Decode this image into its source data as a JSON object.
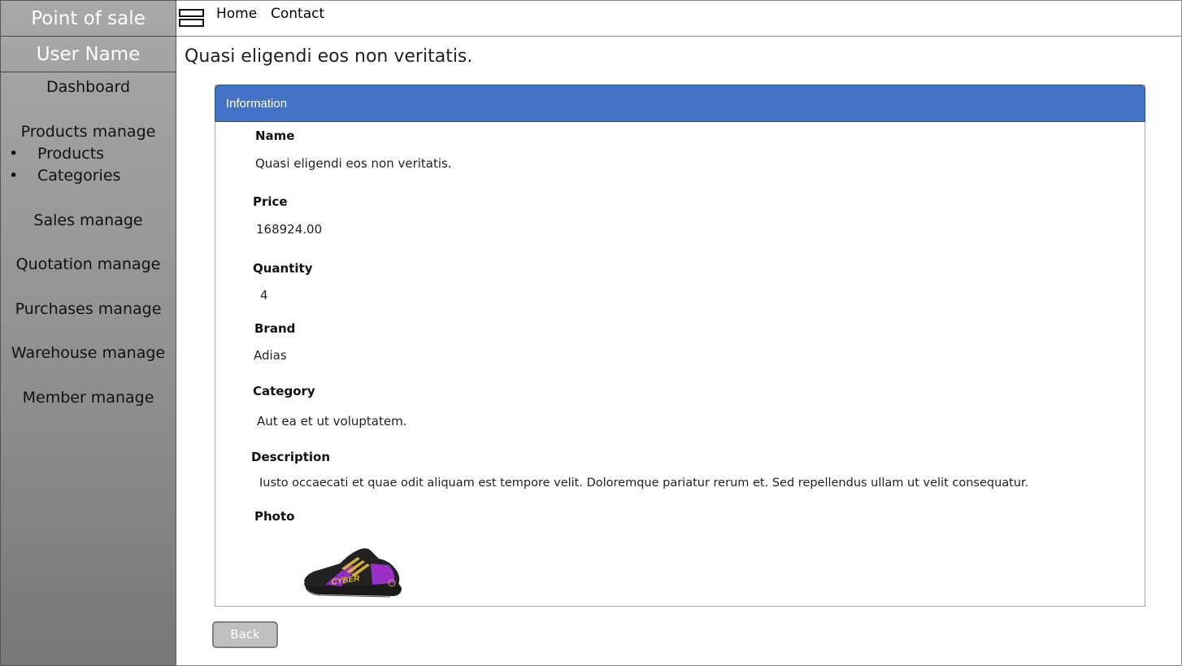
{
  "sidebar": {
    "app_title": "Point of sale",
    "user_name": "User Name",
    "dashboard": "Dashboard",
    "products_manage": "Products manage",
    "products_sub": [
      {
        "bullet": "•",
        "label": "Products"
      },
      {
        "bullet": "•",
        "label": "Categories"
      }
    ],
    "sales_manage": "Sales manage",
    "quotation_manage": "Quotation manage",
    "purchases_manage": "Purchases manage",
    "warehouse_manage": "Warehouse manage",
    "member_manage": "Member manage"
  },
  "topbar": {
    "menu_icon": "hamburger-icon",
    "home": "Home",
    "contact": "Contact"
  },
  "page": {
    "title": "Quasi eligendi eos non veritatis."
  },
  "panel": {
    "header": "Information",
    "header_color": "#4472c4",
    "fields": {
      "name": {
        "label": "Name",
        "value": "Quasi eligendi eos non veritatis."
      },
      "price": {
        "label": "Price",
        "value": "168924.00"
      },
      "quantity": {
        "label": "Quantity",
        "value": "4"
      },
      "brand": {
        "label": "Brand",
        "value": "Adias"
      },
      "category": {
        "label": "Category",
        "value": "Aut ea et ut voluptatem."
      },
      "description": {
        "label": "Description",
        "value": "Iusto occaecati et quae odit aliquam est tempore velit. Doloremque pariatur rerum et. Sed repellendus ullam ut velit consequatur."
      },
      "photo": {
        "label": "Photo",
        "image": "sneaker-photo"
      }
    }
  },
  "actions": {
    "back": "Back"
  }
}
